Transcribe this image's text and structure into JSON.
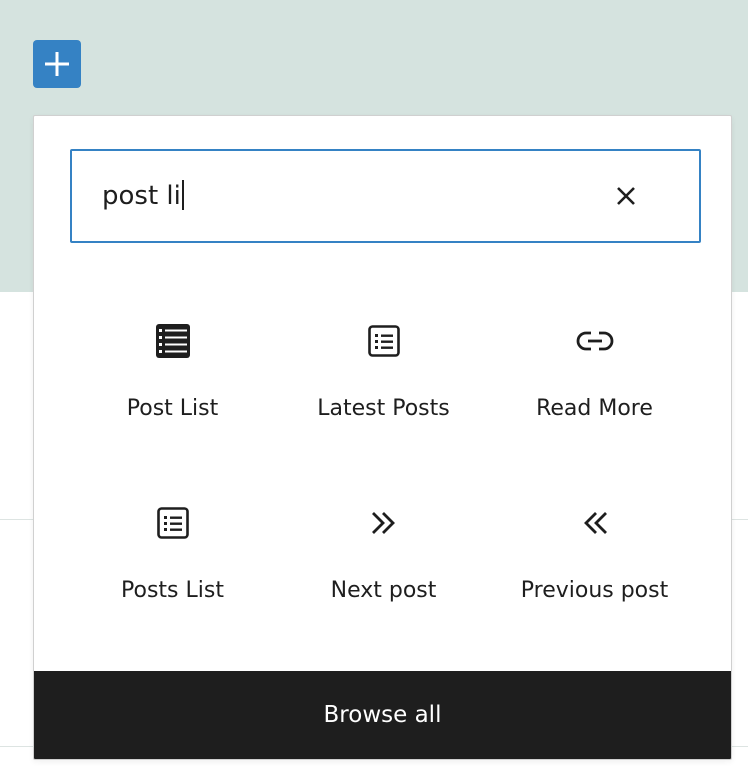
{
  "inserter": {
    "toggle_icon": "plus-icon",
    "search": {
      "value": "post li",
      "clear_icon": "close-icon"
    },
    "results": [
      {
        "label": "Post List",
        "icon": "list-view-icon"
      },
      {
        "label": "Latest Posts",
        "icon": "post-list-icon"
      },
      {
        "label": "Read More",
        "icon": "link-icon"
      },
      {
        "label": "Posts List",
        "icon": "post-list-icon"
      },
      {
        "label": "Next post",
        "icon": "chevron-double-right-icon"
      },
      {
        "label": "Previous post",
        "icon": "chevron-double-left-icon"
      }
    ],
    "browse_all_label": "Browse all"
  },
  "colors": {
    "accent": "#3582c4",
    "background_band": "#d5e3df",
    "footer": "#1e1e1e",
    "text": "#1e1e1e"
  }
}
